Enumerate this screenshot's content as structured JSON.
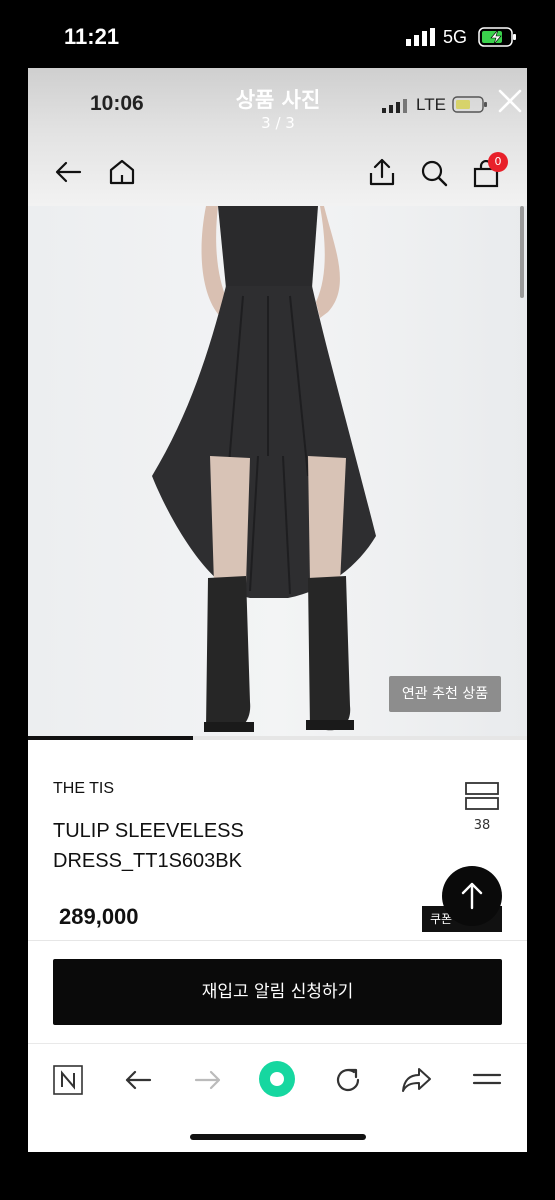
{
  "outer_status": {
    "time": "11:21",
    "network": "5G"
  },
  "inner_status": {
    "time": "10:06",
    "network": "LTE"
  },
  "viewer": {
    "title": "상품 사진",
    "page_indicator": "3 / 3"
  },
  "cart": {
    "badge_count": "0"
  },
  "photo": {
    "related_label": "연관 추천 상품",
    "gallery_progress": 0.33
  },
  "product": {
    "brand": "THE TIS",
    "name": "TULIP SLEEVELESS DRESS_TT1S603BK",
    "price": "289,000",
    "like_count": "38",
    "coupon_label": "쿠폰"
  },
  "actions": {
    "restock_label": "재입고 알림 신청하기"
  },
  "icons": {
    "top_nav": [
      "back-arrow-icon",
      "home-icon",
      "share-icon",
      "search-icon",
      "cart-icon"
    ],
    "browser": [
      "naver-n-icon",
      "back-arrow-icon",
      "forward-arrow-icon",
      "green-circle-icon",
      "refresh-icon",
      "share-icon",
      "menu-icon"
    ]
  },
  "colors": {
    "badge": "#e8202a",
    "accent_green": "#16d7a0",
    "button_dark": "#0a0a0a"
  }
}
